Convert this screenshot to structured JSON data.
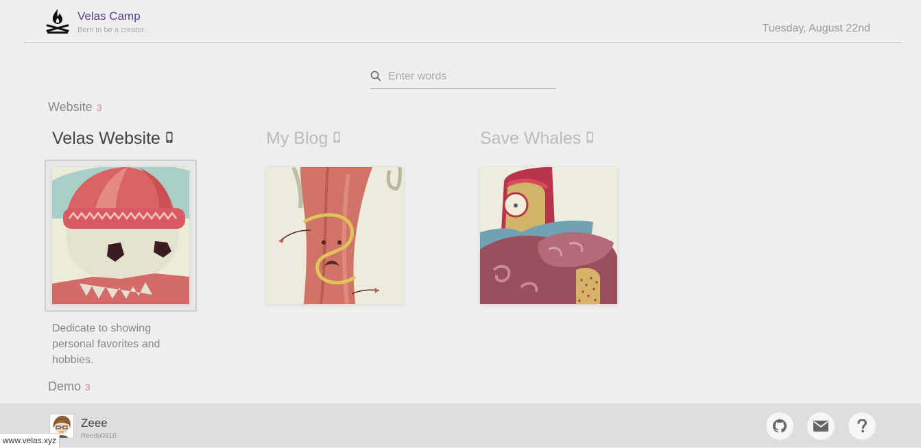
{
  "header": {
    "brand_title": "Velas Camp",
    "brand_subtitle": "Born to be a creator.",
    "date": "Tuesday, August 22nd",
    "logo_icon": "campfire-icon"
  },
  "search": {
    "placeholder": "Enter words",
    "value": "",
    "icon": "search-icon"
  },
  "sections": [
    {
      "label": "Website",
      "count": "3",
      "cards": [
        {
          "title": "Velas Website",
          "icon": "mobile-phone-icon",
          "selected": true,
          "description": "Dedicate to showing personal favorites and hobbies."
        },
        {
          "title": "My Blog",
          "icon": "mobile-phone-icon",
          "selected": false
        },
        {
          "title": "Save Whales",
          "icon": "mobile-phone-icon",
          "selected": false
        }
      ]
    },
    {
      "label": "Demo",
      "count": "3"
    }
  ],
  "footer": {
    "user_name": "Zeee",
    "user_handle": "Reedo0910",
    "buttons": [
      "github-icon",
      "mail-icon",
      "help-icon"
    ]
  },
  "status_bar": {
    "url": "www.velas.xyz"
  },
  "colors": {
    "brand": "#5a3d8a",
    "background": "#efefef",
    "footer": "#dedede",
    "count_accent": "#c49090"
  }
}
